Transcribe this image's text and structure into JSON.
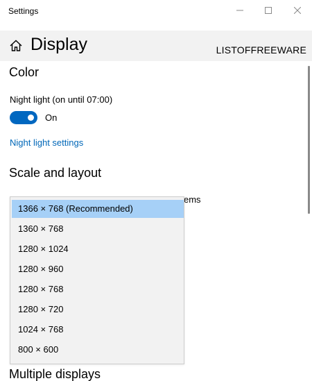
{
  "window": {
    "title": "Settings",
    "controls": {
      "minimize": "minimize-icon",
      "maximize": "maximize-icon",
      "close": "close-icon"
    }
  },
  "header": {
    "icon": "home-icon",
    "title": "Display",
    "watermark": "LISTOFFREEWARE"
  },
  "color_section": {
    "title": "Color",
    "night_light_label": "Night light (on until 07:00)",
    "toggle_state": "On",
    "toggle_on": true,
    "night_light_link": "Night light settings"
  },
  "scale_section": {
    "title": "Scale and layout",
    "partial_text": "ems"
  },
  "resolution_dropdown": {
    "selected_index": 0,
    "options": [
      "1366 × 768 (Recommended)",
      "1360 × 768",
      "1280 × 1024",
      "1280 × 960",
      "1280 × 768",
      "1280 × 720",
      "1024 × 768",
      "800 × 600"
    ]
  },
  "multiple_displays": {
    "title": "Multiple displays"
  },
  "colors": {
    "accent": "#0067c0",
    "link": "#0067b8",
    "selection": "#a6d0f7",
    "header_bg": "#f2f2f2"
  }
}
